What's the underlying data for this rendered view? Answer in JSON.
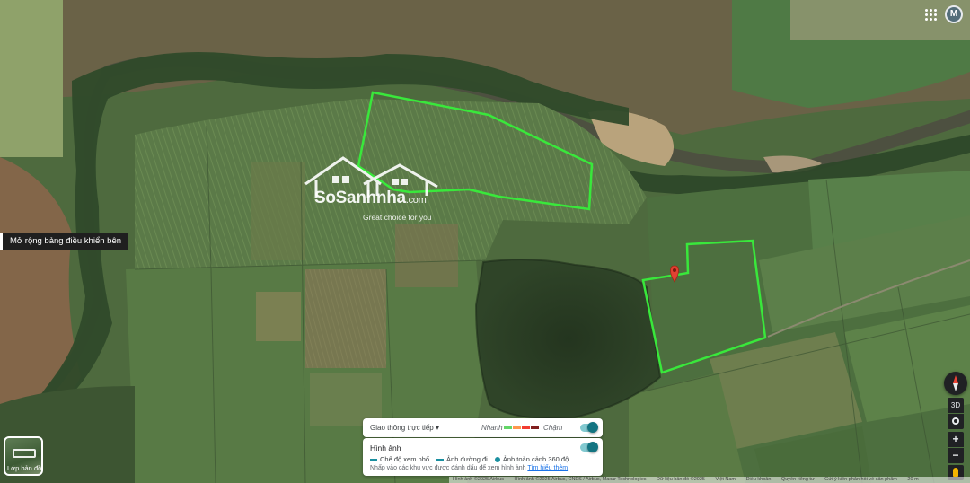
{
  "map": {
    "view": "satellite",
    "boundary_color": "#39e83b",
    "pin_color": "#e34133",
    "pin_icon": "map-pin-icon"
  },
  "watermark": {
    "brand_main": "SoSanhnha",
    "brand_suffix": ".com",
    "tagline": "Great choice for you"
  },
  "sidebar": {
    "expand_tooltip": "Mở rộng bảng điều khiển bên"
  },
  "account": {
    "apps_icon": "apps-grid-icon",
    "avatar_initial": "M"
  },
  "layers": {
    "label": "Lớp bản đồ"
  },
  "traffic": {
    "label": "Giao thông trực tiếp",
    "fast_label": "Nhanh",
    "slow_label": "Chậm",
    "scale_colors": [
      "#63d668",
      "#ff974d",
      "#f23c32",
      "#811f1f"
    ],
    "enabled": true
  },
  "imagery": {
    "title": "Hình ảnh",
    "enabled": true,
    "legend": [
      "Chế độ xem phố",
      "Ảnh đường đi",
      "Ảnh toàn cảnh 360 độ"
    ],
    "hint": "Nhấp vào các khu vực được đánh dấu để xem hình ảnh",
    "learn_more": "Tìm hiểu thêm"
  },
  "controls": {
    "compass_icon": "compass-icon",
    "view_3d": "3D",
    "zoom_in": "+",
    "zoom_out": "−"
  },
  "attribution": {
    "items": [
      "Hình ảnh ©2025 Airbus",
      "Hình ảnh ©2025 Airbus, CNES / Airbus, Maxar Technologies",
      "Dữ liệu bản đồ ©2025",
      "Việt Nam",
      "Điều khoản",
      "Quyền riêng tư",
      "Gửi ý kiến phản hồi về sản phẩm",
      "20 m"
    ]
  }
}
